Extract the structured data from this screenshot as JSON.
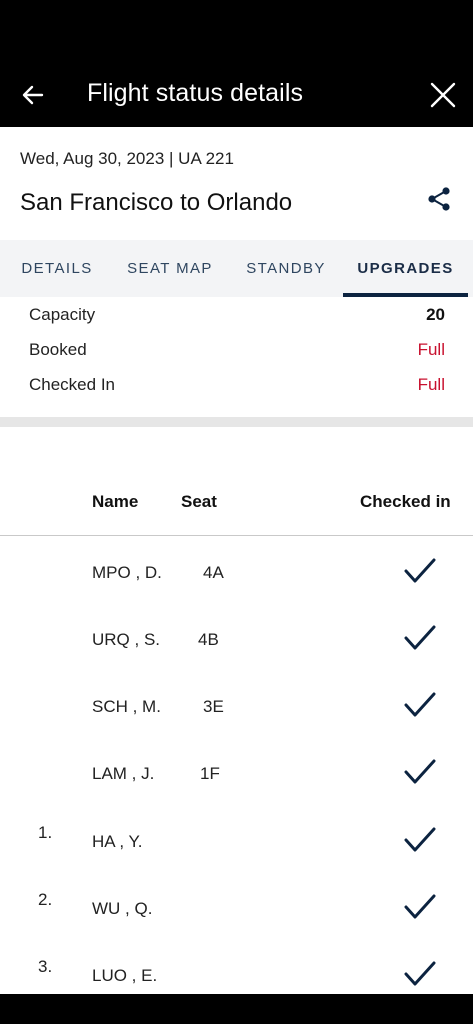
{
  "header": {
    "title": "Flight status details",
    "back_icon": "arrow-left-icon",
    "close_icon": "close-icon"
  },
  "flight": {
    "date_line": "Wed, Aug 30, 2023 | UA 221",
    "route": "San Francisco to Orlando",
    "share_icon": "share-icon"
  },
  "tabs": [
    {
      "label": "DETAILS",
      "active": false
    },
    {
      "label": "SEAT MAP",
      "active": false
    },
    {
      "label": "STANDBY",
      "active": false
    },
    {
      "label": "UPGRADES",
      "active": true
    }
  ],
  "summary": [
    {
      "label": "Capacity",
      "value": "20",
      "color": "#111111"
    },
    {
      "label": "Booked",
      "value": "Full",
      "color": "#c8102e"
    },
    {
      "label": "Checked In",
      "value": "Full",
      "color": "#c8102e"
    }
  ],
  "table": {
    "headers": {
      "name": "Name",
      "seat": "Seat",
      "checked_in": "Checked in"
    },
    "rows": [
      {
        "num": "",
        "name": "MPO , D.",
        "seat": "4A",
        "checked_in": true
      },
      {
        "num": "",
        "name": "URQ , S.",
        "seat": "4B",
        "checked_in": true
      },
      {
        "num": "",
        "name": "SCH , M.",
        "seat": "3E",
        "checked_in": true
      },
      {
        "num": "",
        "name": "LAM , J.",
        "seat": "1F",
        "checked_in": true
      },
      {
        "num": "1.",
        "name": "HA , Y.",
        "seat": "",
        "checked_in": true
      },
      {
        "num": "2.",
        "name": "WU , Q.",
        "seat": "",
        "checked_in": true
      },
      {
        "num": "3.",
        "name": "LUO , E.",
        "seat": "",
        "checked_in": true
      }
    ]
  },
  "colors": {
    "brand_navy": "#0c2340",
    "alert_red": "#c8102e",
    "tab_background": "#f3f4f6"
  }
}
